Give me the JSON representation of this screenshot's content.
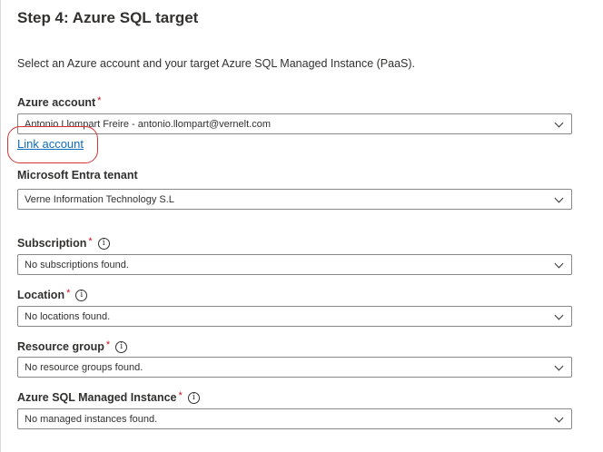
{
  "step_title": "Step 4: Azure SQL target",
  "description": "Select an Azure account and your target Azure SQL Managed Instance (PaaS).",
  "fields": {
    "account": {
      "label": "Azure account",
      "required": "*",
      "value": "Antonio Llompart Freire - antonio.llompart@vernelt.com"
    },
    "link_account": "Link account",
    "tenant": {
      "label": "Microsoft Entra tenant",
      "value": "Verne Information Technology S.L"
    },
    "subscription": {
      "label": "Subscription",
      "required": "*",
      "info": "i",
      "value": "No subscriptions found."
    },
    "location": {
      "label": "Location",
      "required": "*",
      "info": "i",
      "value": "No locations found."
    },
    "resource_group": {
      "label": "Resource group",
      "required": "*",
      "info": "i",
      "value": "No resource groups found."
    },
    "managed_instance": {
      "label": "Azure SQL Managed Instance",
      "required": "*",
      "info": "i",
      "value": "No managed instances found."
    }
  },
  "colors": {
    "link": "#0f6cbd",
    "required": "#c50f1f",
    "highlight": "#d13438"
  },
  "icons": [
    "chevron-down-icon",
    "info-icon"
  ]
}
